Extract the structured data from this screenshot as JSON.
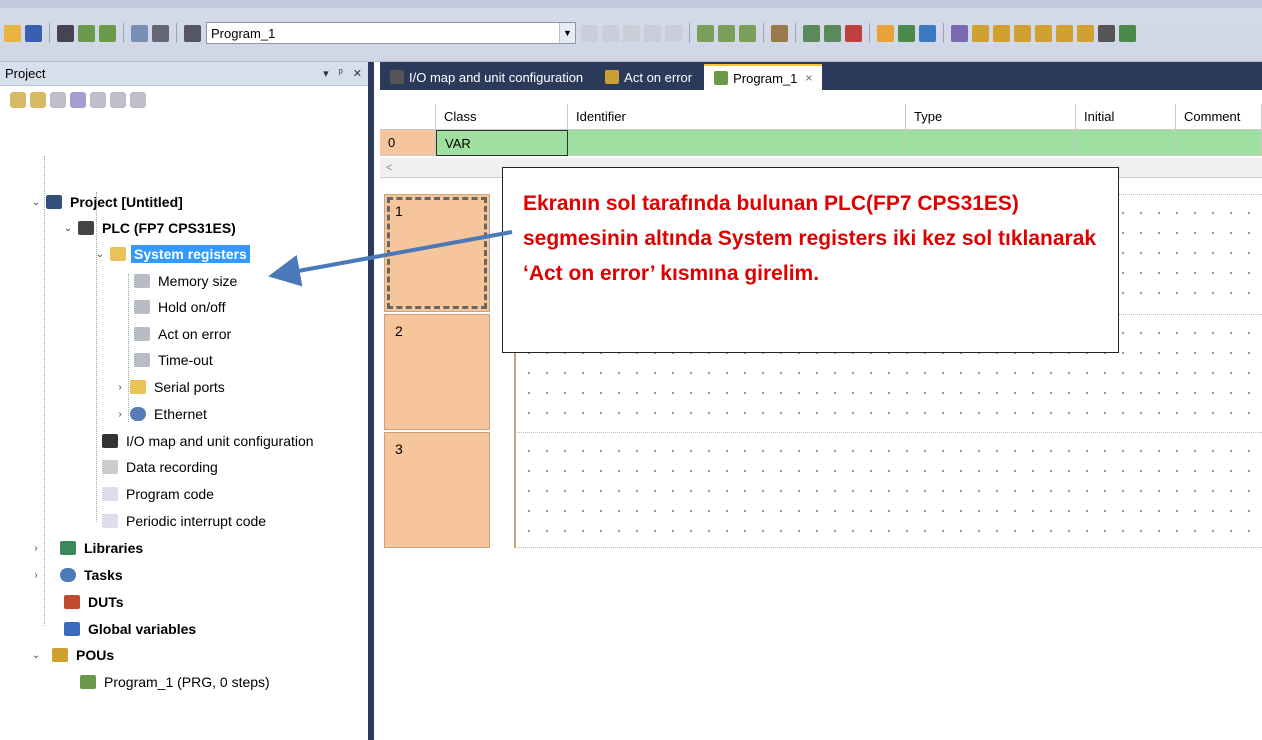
{
  "toolbar": {
    "program_combo_value": "Program_1"
  },
  "project_panel": {
    "title": "Project",
    "pin_symbol": "▾ ᵖ ✕"
  },
  "tree": {
    "project": "Project [Untitled]",
    "plc": "PLC (FP7 CPS31ES)",
    "system_registers": "System registers",
    "memory_size": "Memory size",
    "hold": "Hold on/off",
    "act_on_error": "Act on error",
    "timeout": "Time-out",
    "serial_ports": "Serial ports",
    "ethernet": "Ethernet",
    "io_map": "I/O map and unit configuration",
    "data_recording": "Data recording",
    "program_code": "Program code",
    "periodic": "Periodic interrupt code",
    "libraries": "Libraries",
    "tasks": "Tasks",
    "duts": "DUTs",
    "global_vars": "Global variables",
    "pous": "POUs",
    "program1": "Program_1 (PRG, 0 steps)"
  },
  "tabs": [
    {
      "label": "I/O map and unit configuration"
    },
    {
      "label": "Act on error"
    },
    {
      "label": "Program_1",
      "close": "×"
    }
  ],
  "var_table": {
    "headers": [
      "Class",
      "Identifier",
      "Type",
      "Initial",
      "Comment"
    ],
    "row_index": "0",
    "row_class": "VAR",
    "scroll_left": "<"
  },
  "rungs": [
    "1",
    "2",
    "3"
  ],
  "annotation": {
    "text": "Ekranın sol tarafında bulunan PLC(FP7 CPS31ES) segmesinin altında System registers iki kez sol tıklanarak ‘Act on error’ kısmına girelim."
  },
  "colors": {
    "annotation_text": "#e00000",
    "arrow": "#4a78b8",
    "selection": "#3399ff",
    "row_green": "#9fdf9f",
    "rung_orange": "#f7c59b"
  }
}
